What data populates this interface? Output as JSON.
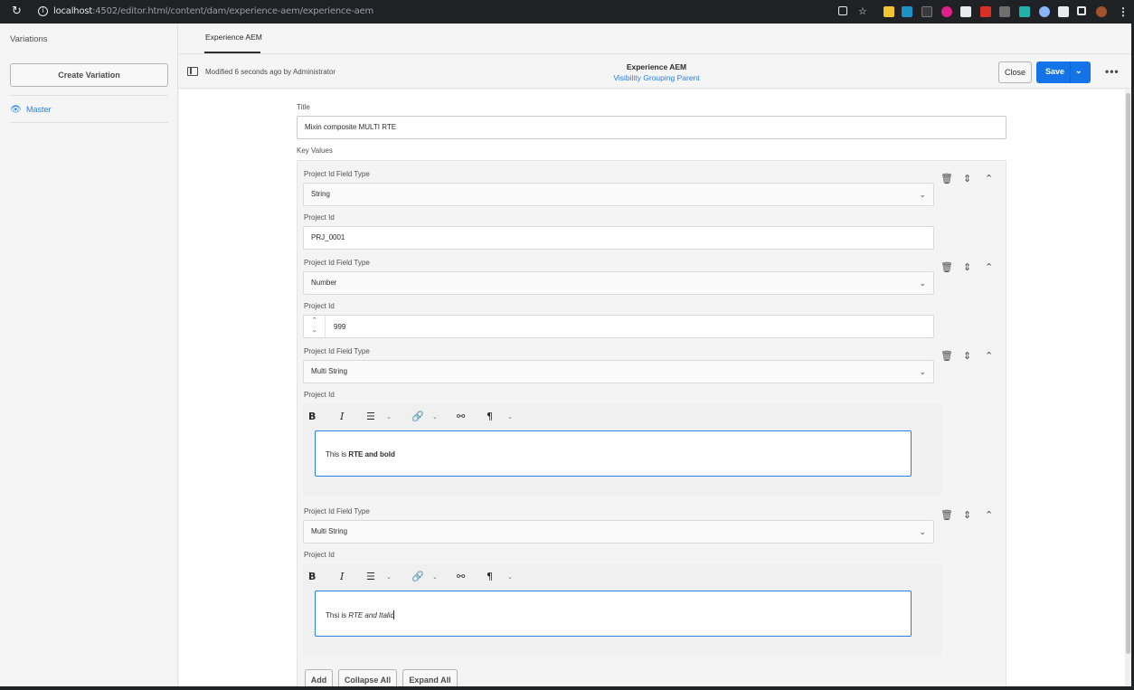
{
  "browser": {
    "reload_icon": "reload-icon",
    "url_host": "localhost",
    "url_rest": ":4502/editor.html/content/dam/experience-aem/experience-aem"
  },
  "sidebar": {
    "title": "Variations",
    "create_button": "Create Variation",
    "master_label": "Master"
  },
  "header": {
    "tab": "Experience AEM",
    "modified": "Modified 6 seconds ago by Administrator",
    "title": "Experience AEM",
    "subtitle": "Visibility Grouping Parent",
    "close_label": "Close",
    "save_label": "Save"
  },
  "form": {
    "title_label": "Title",
    "title_value": "Mixin composite MULTI RTE",
    "key_values_label": "Key Values",
    "items": [
      {
        "type_label": "Project Id Field Type",
        "type_value": "String",
        "id_label": "Project Id",
        "id_value": "PRJ_0001"
      },
      {
        "type_label": "Project Id Field Type",
        "type_value": "Number",
        "id_label": "Project Id",
        "id_value": "999"
      },
      {
        "type_label": "Project Id Field Type",
        "type_value": "Multi String",
        "id_label": "Project Id",
        "rte_plain": "This is ",
        "rte_styled": "RTE and bold"
      },
      {
        "type_label": "Project Id Field Type",
        "type_value": "Multi String",
        "id_label": "Project Id",
        "rte_plain": "Thsi is ",
        "rte_styled": "RTE and Italic"
      }
    ],
    "add_label": "Add",
    "collapse_label": "Collapse All",
    "expand_label": "Expand All"
  }
}
